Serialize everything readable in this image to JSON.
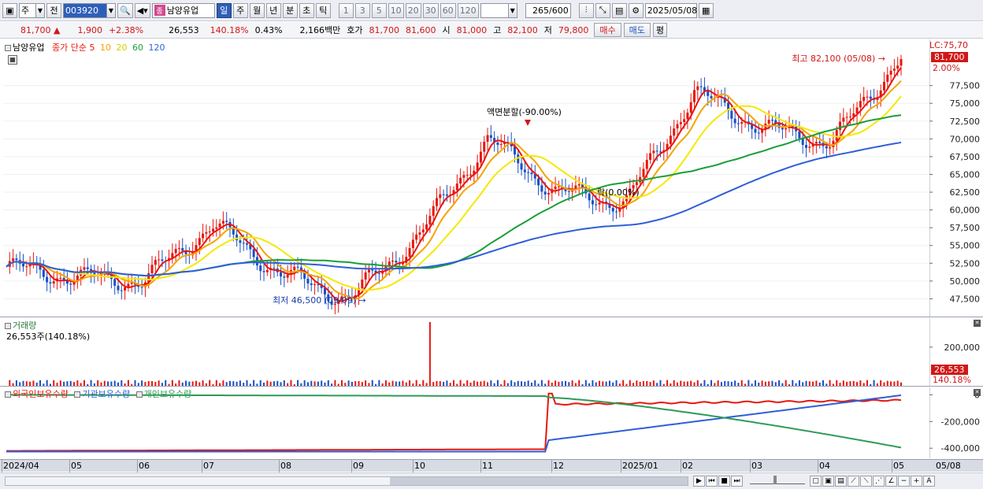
{
  "toolbar": {
    "period": "주",
    "prev_label": "전",
    "code": "003920",
    "stock_name": "남양유업",
    "name_badge": "종",
    "timeframes": [
      "일",
      "주",
      "월",
      "년",
      "분",
      "초",
      "틱"
    ],
    "active_timeframe": "일",
    "intervals": [
      "1",
      "3",
      "5",
      "10",
      "20",
      "30",
      "60",
      "120"
    ],
    "count": "265",
    "count_total": "/600",
    "date": "2025/05/08"
  },
  "quote": {
    "price": "81,700",
    "change": "1,900",
    "change_pct": "+2.38%",
    "volume": "26,553",
    "volume_ratio": "140.18%",
    "turnover": "0.43%",
    "amount": "2,166백만",
    "ask_label": "호가",
    "ask": "81,700",
    "bid": "81,600",
    "open_label": "시",
    "open": "81,000",
    "high_label": "고",
    "high": "82,100",
    "low_label": "저",
    "low": "79,800",
    "buy_label": "매수",
    "sell_label": "매도",
    "eval_label": "평"
  },
  "price_panel": {
    "legend_name": "남양유업",
    "legend_ma": "종가 단순",
    "ma_periods": [
      "5",
      "10",
      "20",
      "60",
      "120"
    ],
    "ma_colors": [
      "#e8160f",
      "#f5a300",
      "#f5e800",
      "#1b9e38",
      "#2f5fd8"
    ],
    "lc_label": "LC:75,70",
    "current_tag": "81,700",
    "pct_tag": "2.00%",
    "high_annotation": "최고 82,100 (05/08)",
    "low_annotation": "최저 46,500 (09/09)",
    "split_annotation": "액면분할(-90.00%)",
    "drop_annotation": "락(0.00%)"
  },
  "volume_panel": {
    "title": "거래량",
    "summary": "26,553주(140.18%)",
    "current_tag": "26,553",
    "pct_tag": "140.18%"
  },
  "holding_panel": {
    "legend": [
      "외국인보유수량",
      "기관보유수량",
      "개인보유수량"
    ],
    "colors": [
      "#e8160f",
      "#2f5fd8",
      "#2e9a58"
    ]
  },
  "x_axis_labels": [
    "2024/04",
    "05",
    "06",
    "07",
    "08",
    "09",
    "10",
    "11",
    "12",
    "2025/01",
    "02",
    "03",
    "04",
    "05"
  ],
  "x_axis_end": "05/08",
  "chart_data": {
    "type": "candlestick",
    "price_axis": {
      "ticks": [
        "77,500",
        "75,000",
        "72,500",
        "70,000",
        "67,500",
        "65,000",
        "62,500",
        "60,000",
        "57,500",
        "55,000",
        "52,500",
        "50,000",
        "47,500"
      ],
      "range": [
        45000,
        84000
      ]
    },
    "price_series": {
      "x": [
        "2024-04",
        "2024-05",
        "2024-06",
        "2024-07",
        "2024-08",
        "2024-09",
        "2024-10",
        "2024-11",
        "2024-12",
        "2025-01",
        "2025-02",
        "2025-03",
        "2025-04",
        "2025-05"
      ],
      "close": [
        52000,
        50500,
        50000,
        58000,
        51000,
        47500,
        56500,
        70000,
        62500,
        61000,
        76500,
        71500,
        69500,
        81700
      ]
    },
    "volume_axis": {
      "ticks": [
        "200,000"
      ],
      "range": [
        0,
        350000
      ]
    },
    "holding_axis": {
      "ticks": [
        "0",
        "-200,000",
        "-400,000"
      ],
      "range": [
        -440000,
        20000
      ]
    }
  }
}
